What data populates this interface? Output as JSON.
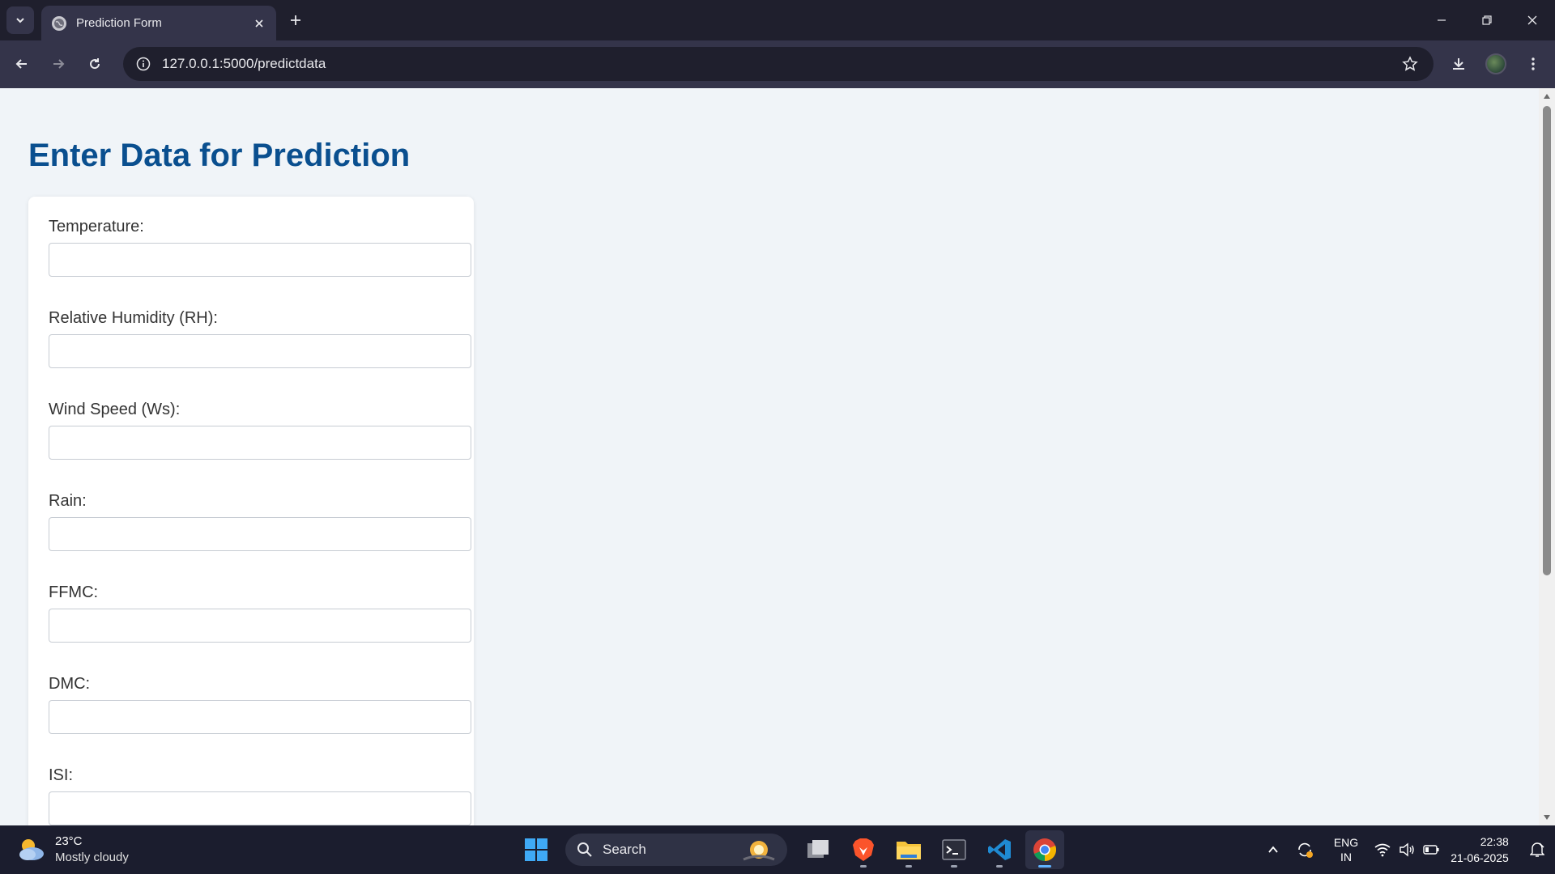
{
  "browser": {
    "tab_title": "Prediction Form",
    "url": "127.0.0.1:5000/predictdata"
  },
  "page": {
    "heading": "Enter Data for Prediction",
    "fields": [
      {
        "label": "Temperature:",
        "value": "",
        "placeholder": ""
      },
      {
        "label": "Relative Humidity (RH):",
        "value": "",
        "placeholder": ""
      },
      {
        "label": "Wind Speed (Ws):",
        "value": "",
        "placeholder": ""
      },
      {
        "label": "Rain:",
        "value": "",
        "placeholder": ""
      },
      {
        "label": "FFMC:",
        "value": "",
        "placeholder": ""
      },
      {
        "label": "DMC:",
        "value": "",
        "placeholder": ""
      },
      {
        "label": "ISI:",
        "value": "",
        "placeholder": ""
      }
    ]
  },
  "taskbar": {
    "weather_temp": "23°C",
    "weather_condition": "Mostly cloudy",
    "search_label": "Search",
    "lang_line1": "ENG",
    "lang_line2": "IN",
    "time": "22:38",
    "date": "21-06-2025"
  },
  "colors": {
    "heading": "#0a4f8f",
    "page_bg": "#f0f4f8",
    "chrome_dark": "#1f1f2d",
    "chrome_mid": "#34344a"
  }
}
